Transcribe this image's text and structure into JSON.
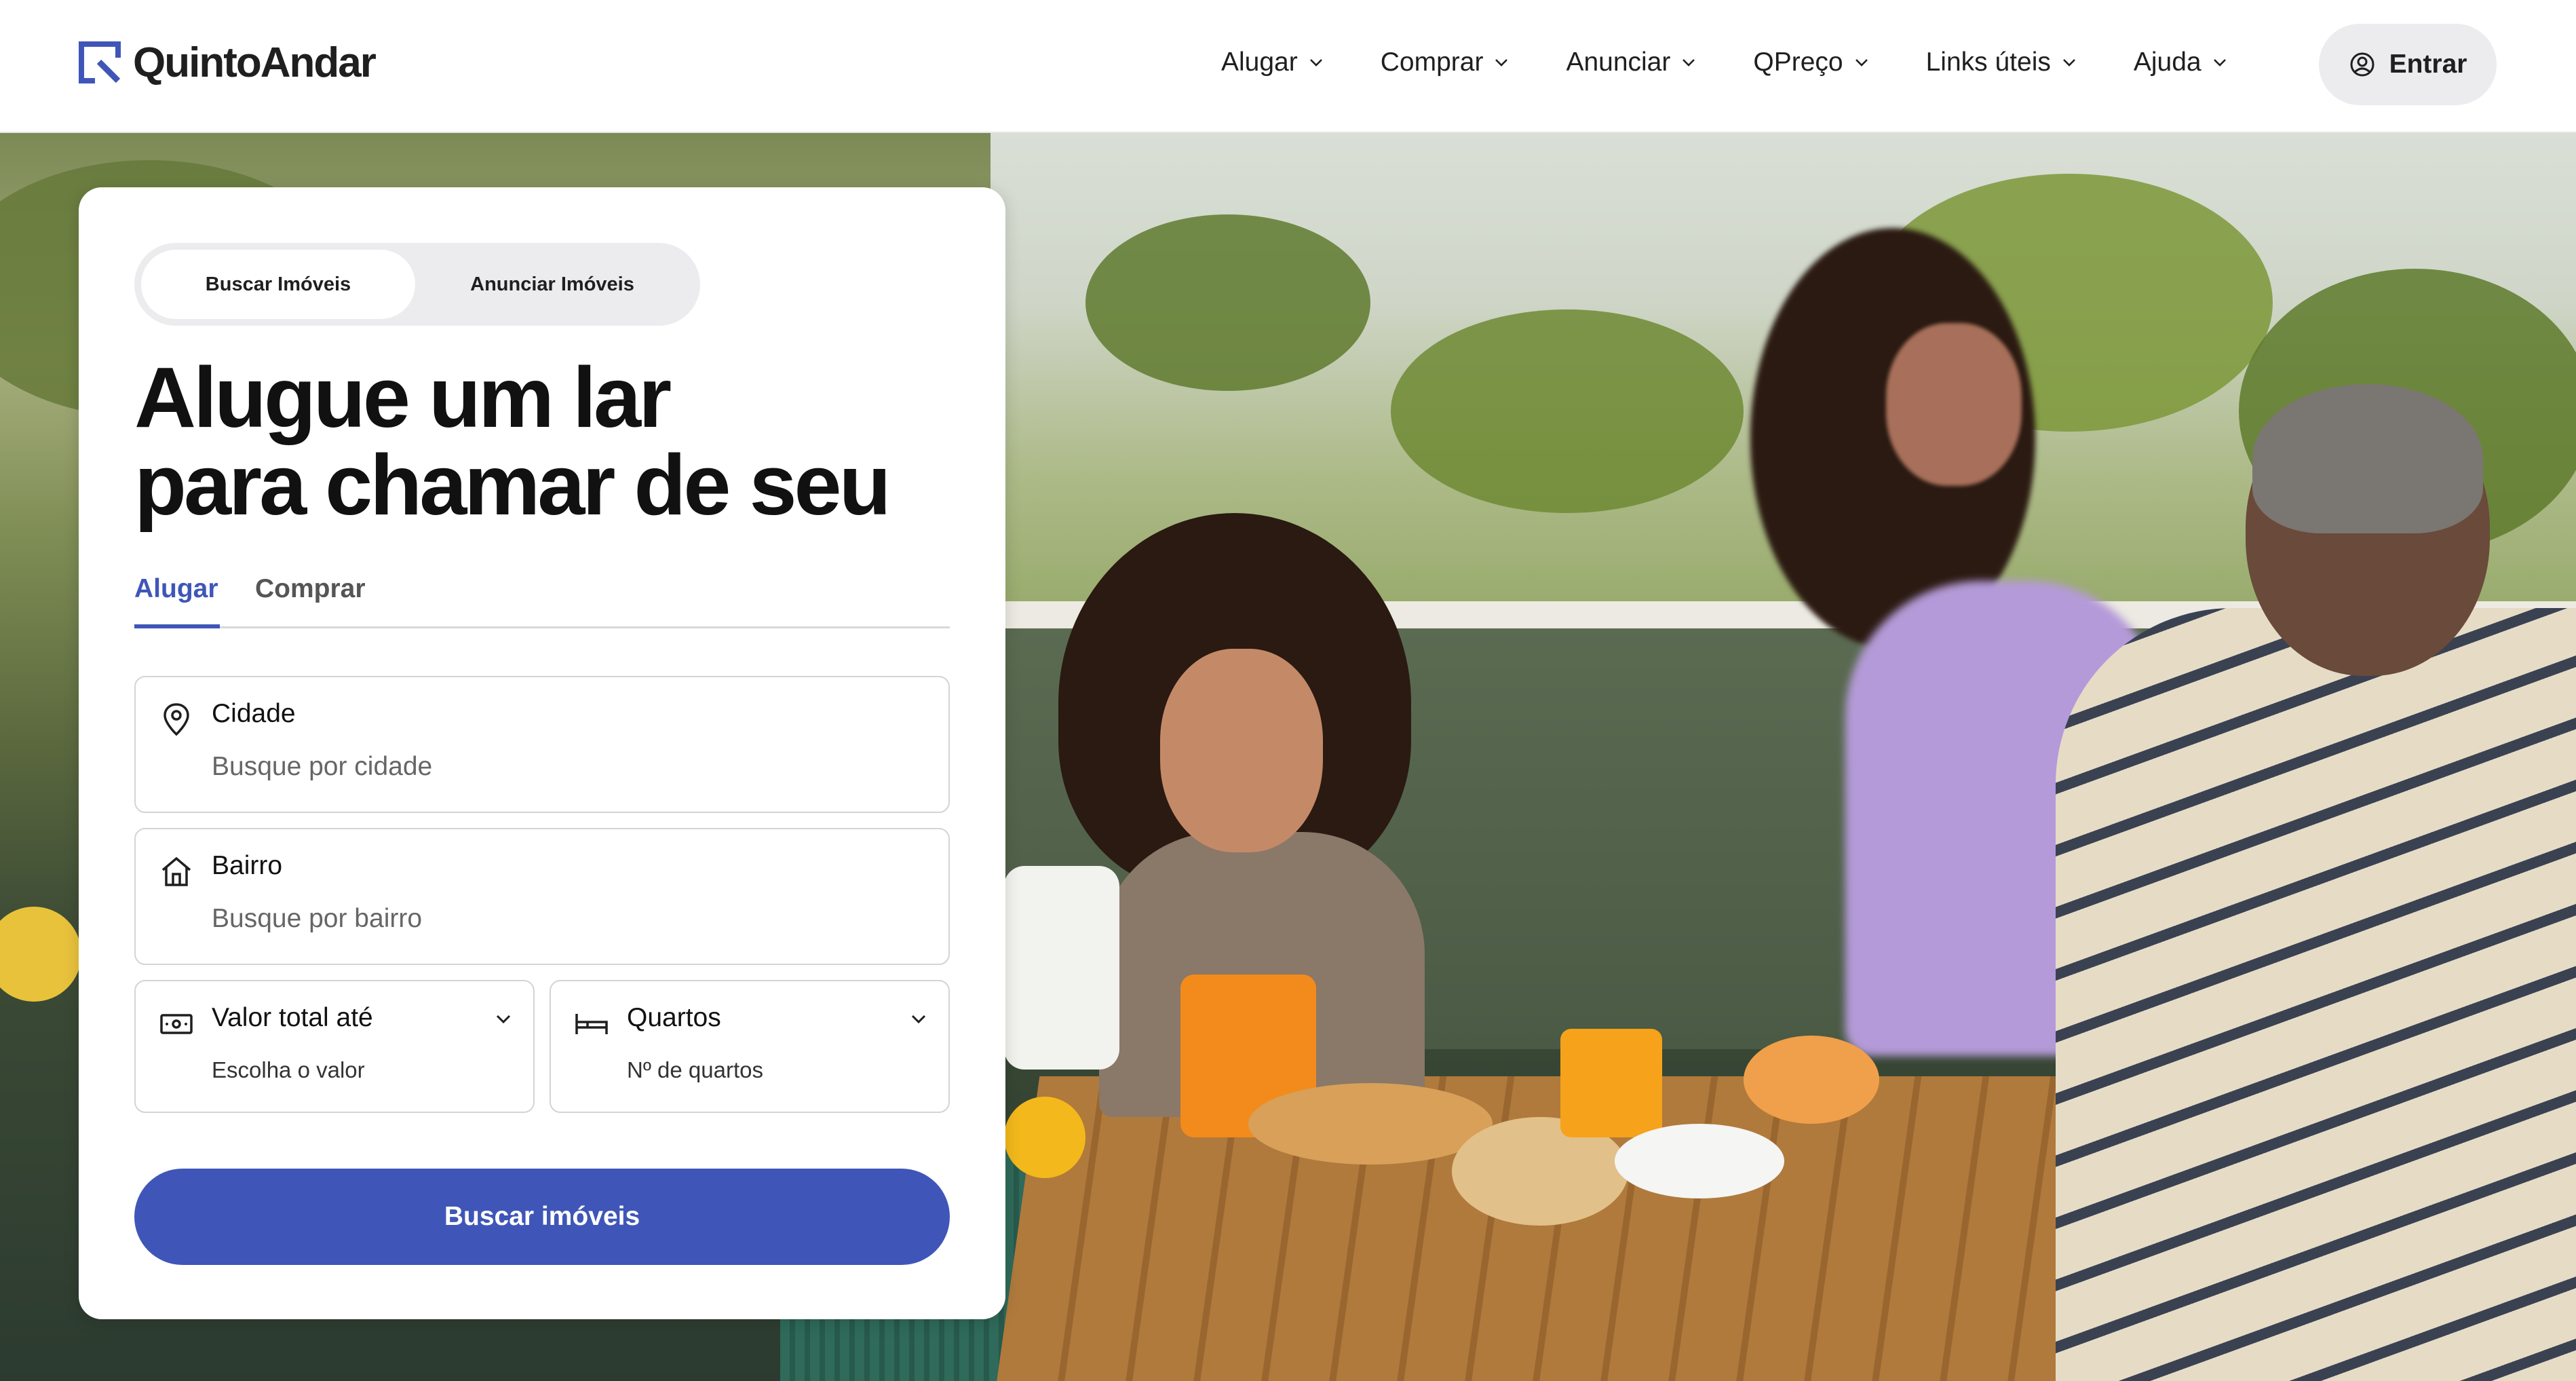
{
  "header": {
    "logo_text": "QuintoAndar",
    "nav": [
      {
        "label": "Alugar"
      },
      {
        "label": "Comprar"
      },
      {
        "label": "Anunciar"
      },
      {
        "label": "QPreço"
      },
      {
        "label": "Links úteis"
      },
      {
        "label": "Ajuda"
      }
    ],
    "login_label": "Entrar"
  },
  "search_card": {
    "segment": {
      "active": "Buscar Imóveis",
      "other": "Anunciar Imóveis"
    },
    "headline": {
      "line1": "Alugue um lar",
      "line2": "para chamar de seu"
    },
    "tabs": {
      "active": "Alugar",
      "other": "Comprar"
    },
    "city": {
      "label": "Cidade",
      "placeholder": "Busque por cidade"
    },
    "neighborhood": {
      "label": "Bairro",
      "placeholder": "Busque por bairro"
    },
    "price": {
      "label": "Valor total até",
      "placeholder": "Escolha o valor"
    },
    "rooms": {
      "label": "Quartos",
      "placeholder": "Nº de quartos"
    },
    "submit_label": "Buscar imóveis"
  },
  "colors": {
    "accent": "#3f56b8",
    "text": "#111111",
    "muted": "#666666"
  },
  "icons": [
    "logo-mark-icon",
    "chevron-down-icon",
    "user-circle-icon",
    "location-pin-icon",
    "house-icon",
    "money-icon",
    "bed-icon"
  ]
}
